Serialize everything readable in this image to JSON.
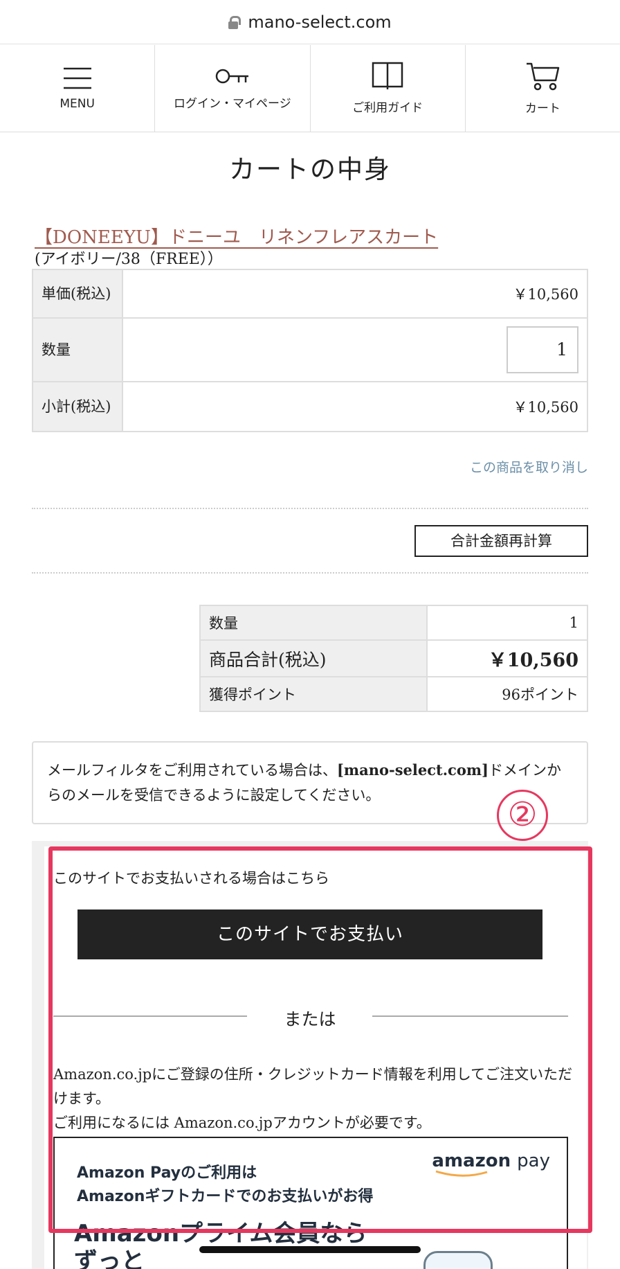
{
  "browser": {
    "url": "mano-select.com"
  },
  "nav": {
    "menu": "MENU",
    "login": "ログイン・マイページ",
    "guide": "ご利用ガイド",
    "cart": "カート"
  },
  "page_title": "カートの中身",
  "product": {
    "name": "【DONEEYU】ドニーユ　リネンフレアスカート",
    "variant": "(アイボリー/38（FREE））",
    "unit_price_label": "単価(税込)",
    "unit_price": "￥10,560",
    "qty_label": "数量",
    "qty": "1",
    "subtotal_label": "小計(税込)",
    "subtotal": "￥10,560",
    "cancel": "この商品を取り消し"
  },
  "recalc_label": "合計金額再計算",
  "summary": {
    "qty_label": "数量",
    "qty": "1",
    "total_label": "商品合計(税込)",
    "total": "￥10,560",
    "points_label": "獲得ポイント",
    "points": "96ポイント"
  },
  "notice": {
    "before": "メールフィルタをご利用されている場合は、",
    "domain": "[mano-select.com]",
    "after": "ドメインからのメールを受信できるように設定してください。"
  },
  "annotation_number": "②",
  "payment": {
    "intro": "このサイトでお支払いされる場合はこちら",
    "button": "このサイトでお支払い",
    "or": "または",
    "amazon_desc_1": "Amazon.co.jpにご登録の住所・クレジットカード情報を利用してご注文いただけます。",
    "amazon_desc_2": "ご利用になるには Amazon.co.jpアカウントが必要です。",
    "banner_line1": "Amazon Payのご利用は",
    "banner_line2": "Amazonギフトカードでのお支払いがお得",
    "banner_big1": "Amazonプライム会員なら",
    "banner_big2": "ずっと",
    "logo_amazon": "amazon",
    "logo_pay": "pay"
  },
  "colors": {
    "accent_red": "#e6385f",
    "product_link": "#a05a4e",
    "cancel_link": "#6b8fa8",
    "pay_button": "#232323"
  }
}
